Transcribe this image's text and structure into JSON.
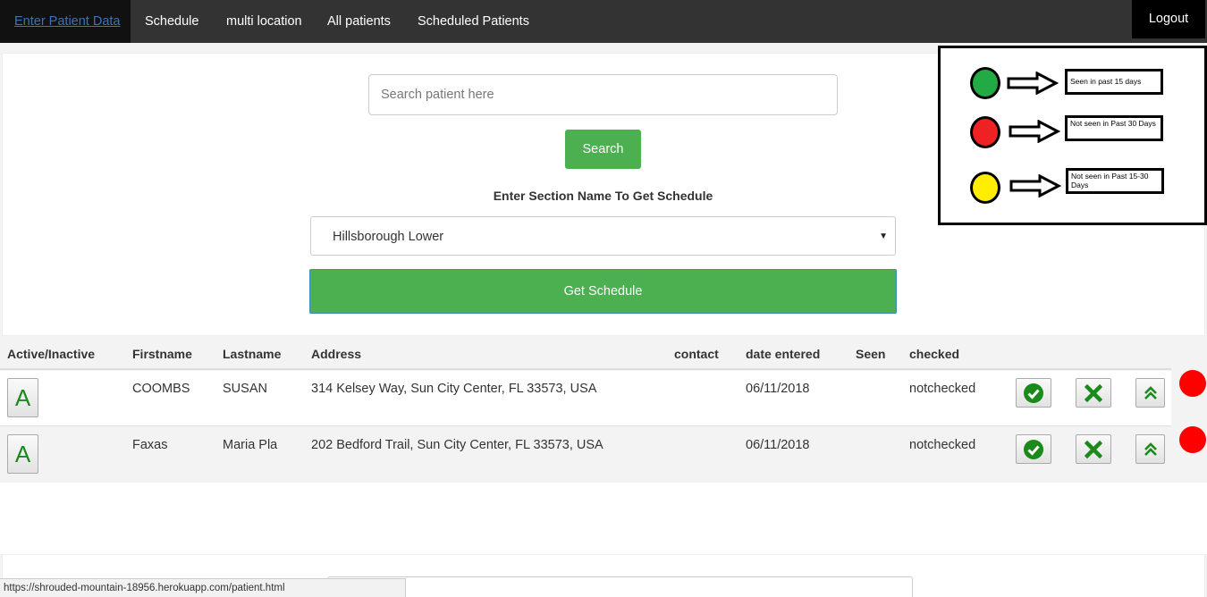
{
  "nav": {
    "items": [
      {
        "label": "Enter Patient Data",
        "active": true
      },
      {
        "label": "Schedule"
      },
      {
        "label": "multi location"
      },
      {
        "label": "All patients"
      },
      {
        "label": "Scheduled Patients"
      }
    ],
    "logout": "Logout"
  },
  "search": {
    "placeholder": "Search patient here",
    "button": "Search"
  },
  "section": {
    "label": "Enter Section Name To Get Schedule",
    "selected": "Hillsborough Lower",
    "button": "Get Schedule"
  },
  "legend": {
    "items": [
      {
        "color": "#22aa44",
        "text": "Seen in past 15 days"
      },
      {
        "color": "#ee2222",
        "text": "Not seen in Past 30 Days"
      },
      {
        "color": "#ffee00",
        "text": "Not seen in Past 15-30 Days"
      }
    ]
  },
  "table": {
    "headers": [
      "Active/Inactive",
      "Firstname",
      "Lastname",
      "Address",
      "contact",
      "date entered",
      "Seen",
      "checked"
    ],
    "rows": [
      {
        "status_button": "A",
        "firstname": "COOMBS",
        "lastname": "SUSAN",
        "address": "314 Kelsey Way, Sun City Center, FL 33573, USA",
        "contact": "",
        "date_entered": "06/11/2018",
        "seen": "",
        "checked": "notchecked",
        "indicator_color": "#ff0000"
      },
      {
        "status_button": "A",
        "firstname": "Faxas",
        "lastname": "Maria Pla",
        "address": "202 Bedford Trail, Sun City Center, FL 33573, USA",
        "contact": "",
        "date_entered": "06/11/2018",
        "seen": "",
        "checked": "notchecked",
        "indicator_color": "#ff0000"
      }
    ]
  },
  "status_bar": {
    "url": "https://shrouded-mountain-18956.herokuapp.com/patient.html"
  },
  "colors": {
    "navbar": "#333333",
    "button_green": "#4caf50",
    "icon_green": "#1a8a1a"
  }
}
